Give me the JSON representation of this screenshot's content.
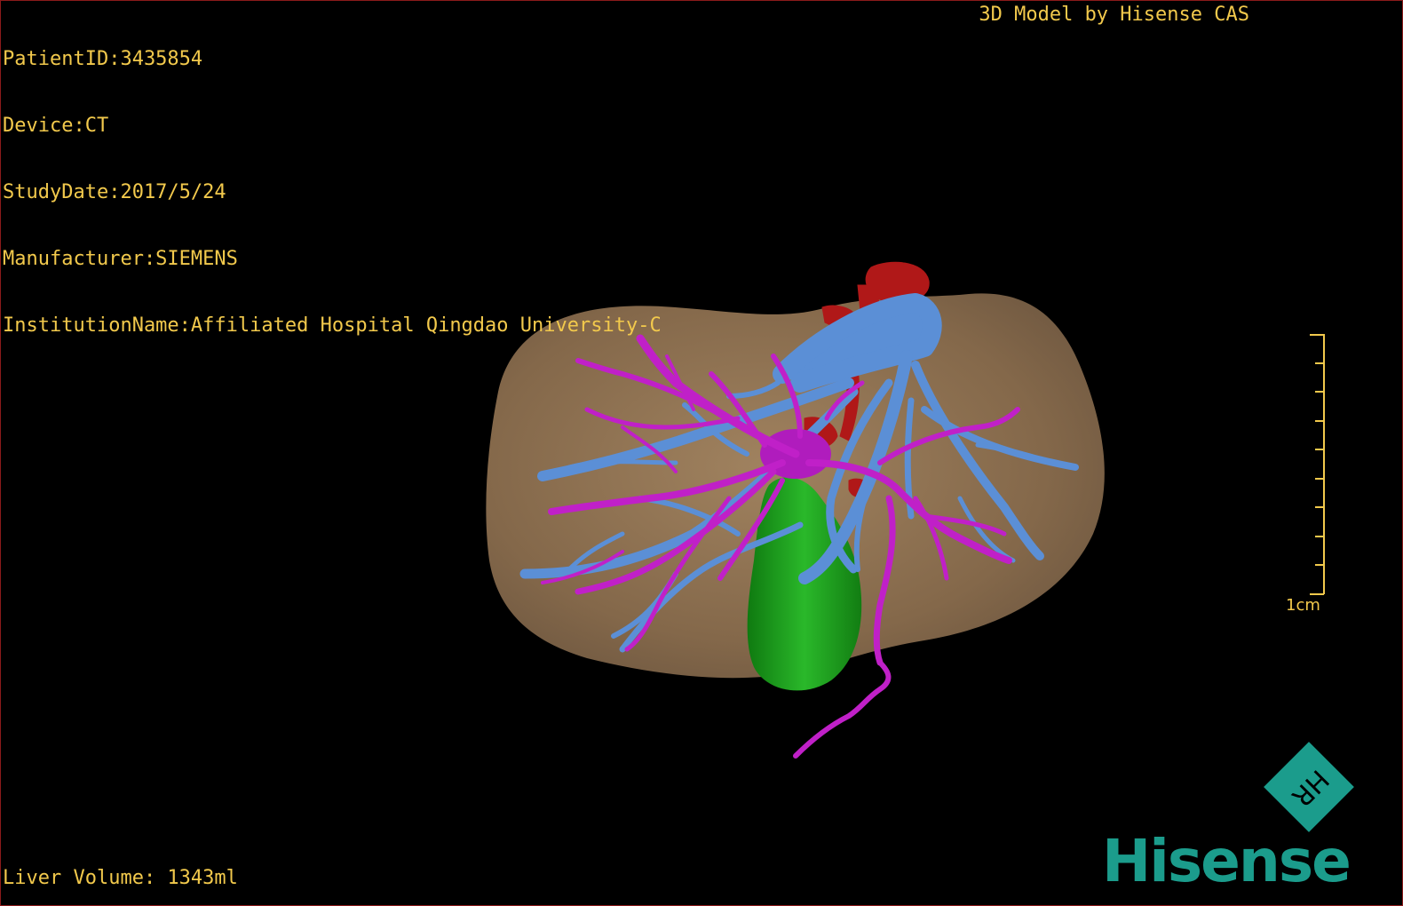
{
  "overlay": {
    "patient_id": "PatientID:3435854",
    "device": "Device:CT",
    "study_date": "StudyDate:2017/5/24",
    "manufacturer": "Manufacturer:SIEMENS",
    "institution": "InstitutionName:Affiliated Hospital Qingdao University-C",
    "credit": "3D Model by Hisense CAS",
    "liver_volume": "Liver Volume: 1343ml"
  },
  "scale": {
    "label": "1cm"
  },
  "logo": {
    "brand": "Hisense",
    "monogram": "HR"
  },
  "colors": {
    "text": "#f2c94c",
    "liver": "#8a6d4f",
    "portal_vein": "#c020c8",
    "hepatic_vein": "#5b8fd6",
    "artery": "#b01818",
    "gallbladder": "#1a9a1a",
    "brand": "#1b9c8c",
    "border": "#8b1a1a"
  },
  "icons": [
    "hisense-hr-logo-icon",
    "scale-bar-icon"
  ]
}
